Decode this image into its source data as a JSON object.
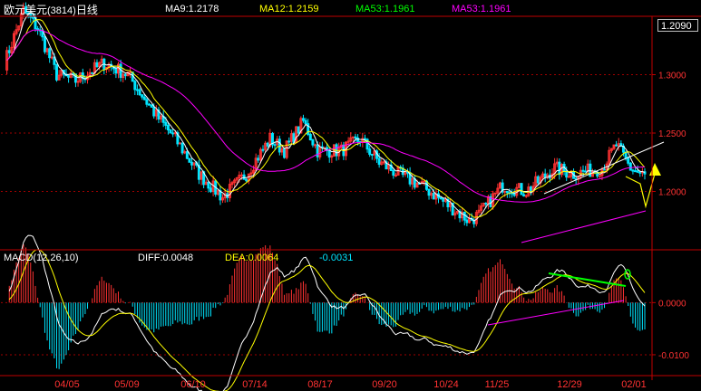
{
  "header": {
    "title": "欧元美元",
    "code": "(3814)",
    "period": "日线",
    "ma9": "MA9:1.2178",
    "ma12": "MA12:1.2159",
    "ma53a": "MA53:1.1961",
    "ma53b": "MA53:1.1961"
  },
  "current_price": "1.2090",
  "macd_header": {
    "label": "MACD(12,26,10)",
    "diff": "DIFF:0.0048",
    "dea": "DEA:0.0064",
    "macd": "-0.0031"
  },
  "colors": {
    "up": "#ff3232",
    "down": "#00e5ff",
    "ma_short": "#ffffff",
    "ma_mid": "#ffff00",
    "ma_long": "#ff00ff",
    "grid": "#a00000",
    "axis": "#c00000",
    "trend_green": "#00ff00"
  },
  "chart_data": [
    {
      "type": "candlestick",
      "x_ticks": [
        "04/05",
        "05/09",
        "06/10",
        "07/14",
        "08/17",
        "09/20",
        "10/24",
        "11/25",
        "12/29",
        "02/01"
      ],
      "y_ticks": [
        "1.3000",
        "1.2500",
        "1.2000"
      ],
      "ylim": [
        1.15,
        1.35
      ],
      "series": [
        {
          "name": "MA9",
          "value": 1.2178
        },
        {
          "name": "MA12",
          "value": 1.2159
        },
        {
          "name": "MA53",
          "value": 1.1961
        }
      ],
      "close_path": [
        {
          "x": 0,
          "y": 1.31
        },
        {
          "x": 8,
          "y": 1.355
        },
        {
          "x": 14,
          "y": 1.34
        },
        {
          "x": 22,
          "y": 1.3
        },
        {
          "x": 30,
          "y": 1.295
        },
        {
          "x": 42,
          "y": 1.31
        },
        {
          "x": 52,
          "y": 1.3
        },
        {
          "x": 64,
          "y": 1.265
        },
        {
          "x": 72,
          "y": 1.245
        },
        {
          "x": 82,
          "y": 1.215
        },
        {
          "x": 92,
          "y": 1.195
        },
        {
          "x": 102,
          "y": 1.215
        },
        {
          "x": 112,
          "y": 1.245
        },
        {
          "x": 118,
          "y": 1.235
        },
        {
          "x": 126,
          "y": 1.26
        },
        {
          "x": 132,
          "y": 1.235
        },
        {
          "x": 142,
          "y": 1.235
        },
        {
          "x": 150,
          "y": 1.245
        },
        {
          "x": 158,
          "y": 1.225
        },
        {
          "x": 166,
          "y": 1.215
        },
        {
          "x": 176,
          "y": 1.205
        },
        {
          "x": 186,
          "y": 1.19
        },
        {
          "x": 196,
          "y": 1.175
        },
        {
          "x": 200,
          "y": 1.18
        },
        {
          "x": 210,
          "y": 1.205
        },
        {
          "x": 220,
          "y": 1.2
        },
        {
          "x": 232,
          "y": 1.22
        },
        {
          "x": 240,
          "y": 1.215
        },
        {
          "x": 252,
          "y": 1.22
        },
        {
          "x": 258,
          "y": 1.24
        },
        {
          "x": 264,
          "y": 1.22
        },
        {
          "x": 270,
          "y": 1.213
        }
      ]
    },
    {
      "type": "bar",
      "name": "MACD",
      "y_ticks": [
        "0.0000",
        "-0.0100"
      ],
      "ylim": [
        -0.014,
        0.007
      ],
      "diff": 0.0048,
      "dea": 0.0064,
      "macd": -0.0031
    }
  ]
}
